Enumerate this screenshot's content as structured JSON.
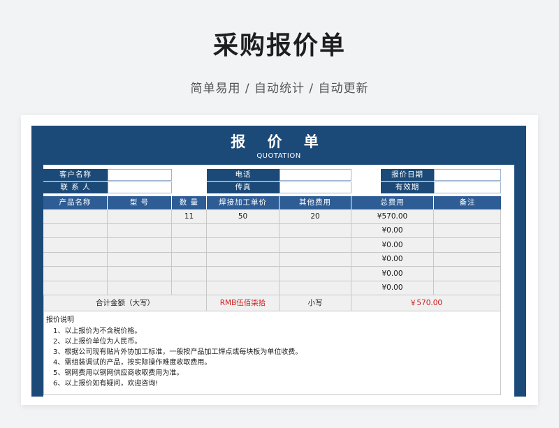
{
  "page": {
    "title": "采购报价单",
    "subtitle": "简单易用 / 自动统计 / 自动更新"
  },
  "sheet": {
    "title": "报 价 单",
    "subtitle": "QUOTATION"
  },
  "info": {
    "customer_label": "客户名称",
    "customer_value": "",
    "contact_label": "联 系 人",
    "contact_value": "",
    "phone_label": "电话",
    "phone_value": "",
    "fax_label": "传真",
    "fax_value": "",
    "date_label": "报价日期",
    "date_value": "",
    "validity_label": "有效期",
    "validity_value": ""
  },
  "table": {
    "headers": [
      "产品名称",
      "型 号",
      "数 量",
      "焊接加工单价",
      "其他费用",
      "总费用",
      "备注"
    ],
    "rows": [
      [
        "",
        "",
        "11",
        "50",
        "20",
        "¥570.00",
        ""
      ],
      [
        "",
        "",
        "",
        "",
        "",
        "¥0.00",
        ""
      ],
      [
        "",
        "",
        "",
        "",
        "",
        "¥0.00",
        ""
      ],
      [
        "",
        "",
        "",
        "",
        "",
        "¥0.00",
        ""
      ],
      [
        "",
        "",
        "",
        "",
        "",
        "¥0.00",
        ""
      ],
      [
        "",
        "",
        "",
        "",
        "",
        "¥0.00",
        ""
      ]
    ],
    "total_label": "合计金额（大写）",
    "total_words": "RMB伍佰柒拾",
    "small_label": "小写",
    "total_number": "￥570.00"
  },
  "notes": {
    "title": "报价说明",
    "items": [
      "1、以上报价为不含税价格。",
      "2、以上报价单位为人民币。",
      "3、根据公司现有贴片外协加工标准，一般按产品加工焊点或每块板为单位收费。",
      "4、需组装调试的产品，按实际操作难度收取费用。",
      "5、钢网费用以钢网供应商收取费用为准。",
      "6、以上报价如有疑问，欢迎咨询!"
    ]
  },
  "colors": {
    "header_navy": "#1c4a78",
    "table_header_blue": "#2e5d95",
    "accent_red": "#cc1e1e"
  }
}
